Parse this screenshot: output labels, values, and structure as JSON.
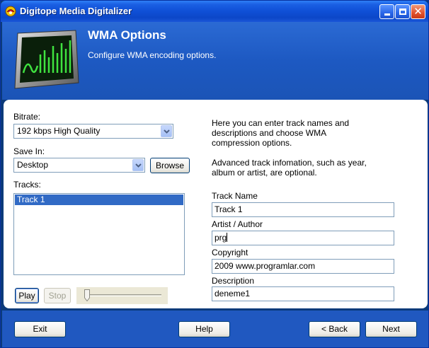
{
  "window": {
    "title": "Digitope Media Digitalizer"
  },
  "header": {
    "title": "WMA Options",
    "subtitle": "Configure WMA encoding options."
  },
  "left": {
    "bitrate_label": "Bitrate:",
    "bitrate_value": "192 kbps High Quality",
    "save_in_label": "Save In:",
    "save_in_value": "Desktop",
    "browse_label": "Browse",
    "tracks_label": "Tracks:",
    "tracks": [
      "Track 1"
    ],
    "play_label": "Play",
    "stop_label": "Stop"
  },
  "right": {
    "info1": "Here you can enter track names and descriptions and choose WMA compression options.",
    "info2": "Advanced track infomation, such as year, album or artist, are optional.",
    "track_name_label": "Track Name",
    "track_name_value": "Track 1",
    "artist_label": "Artist / Author",
    "artist_value": "prg",
    "copyright_label": "Copyright",
    "copyright_value": "2009 www.programlar.com",
    "description_label": "Description",
    "description_value": "deneme1"
  },
  "footer": {
    "exit_label": "Exit",
    "help_label": "Help",
    "back_label": "< Back",
    "next_label": "Next"
  },
  "colors": {
    "title_bar": "#0f4fd6",
    "header_bg": "#1d59c2",
    "selection": "#316ac5"
  },
  "icons": {
    "app": "digitope-app-icon",
    "logo": "waveform-monitor-icon"
  }
}
